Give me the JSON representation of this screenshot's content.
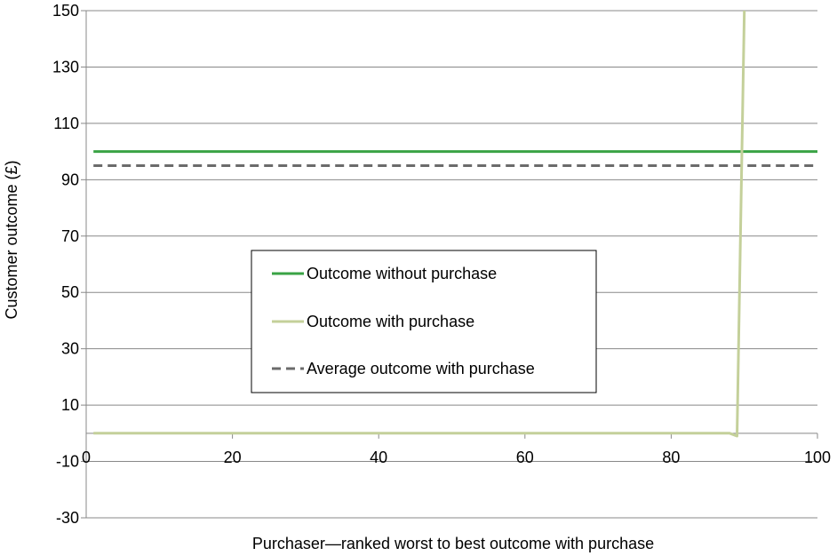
{
  "chart_data": {
    "type": "line",
    "title": "",
    "xlabel": "Purchaser—ranked  worst to best outcome with purchase",
    "ylabel": "Customer outcome (£)",
    "xlim": [
      0,
      100
    ],
    "ylim": [
      -30,
      150
    ],
    "x_ticks": [
      "0",
      "20",
      "40",
      "60",
      "80",
      "100"
    ],
    "y_ticks": [
      "150",
      "130",
      "110",
      "90",
      "70",
      "50",
      "30",
      "10",
      "-10",
      "-30"
    ],
    "x_tick_values": [
      0,
      20,
      40,
      60,
      80,
      100
    ],
    "y_tick_values": [
      150,
      130,
      110,
      90,
      70,
      50,
      30,
      10,
      -10,
      -30
    ],
    "grid": "horizontal",
    "legend_position": "center",
    "series": [
      {
        "name": "Outcome without purchase",
        "color": "#3aa345",
        "style": "solid",
        "x": [
          1,
          100
        ],
        "y": [
          100,
          100
        ]
      },
      {
        "name": "Outcome with purchase",
        "color": "#c4d09a",
        "style": "solid",
        "x": [
          1,
          88,
          89,
          90
        ],
        "y": [
          0,
          0,
          -1,
          150
        ]
      },
      {
        "name": "Average outcome with purchase",
        "color": "#6b6b6b",
        "style": "dashed",
        "x": [
          1,
          100
        ],
        "y": [
          95,
          95
        ]
      }
    ]
  }
}
